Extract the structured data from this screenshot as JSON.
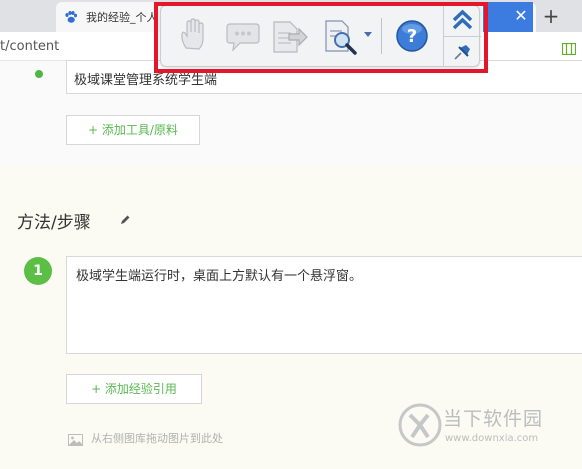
{
  "browser": {
    "tab_title": "我的经验_个人",
    "tab_icon": "baidu-paw-icon",
    "close_glyph": "✕",
    "new_tab_glyph": "+",
    "url_fragment": "t/content",
    "accent": "#3c7ce0"
  },
  "tools_section": {
    "tool_value": "极域课堂管理系统学生端",
    "add_button_label": "+ 添加工具/原料"
  },
  "method_section": {
    "title": "方法/步骤",
    "steps": [
      {
        "number": "1",
        "text": "极域学生端运行时，桌面上方默认有一个悬浮窗。"
      }
    ],
    "add_ref_label": "+ 添加经验引用",
    "image_hint": "从右侧图库拖动图片到此处"
  },
  "floating_toolbar": {
    "buttons": [
      "hand-raise-icon",
      "chat-bubble-icon",
      "file-submit-icon",
      "search-document-icon",
      "help-icon"
    ],
    "side_buttons": [
      "collapse-up-icon",
      "pin-icon"
    ],
    "help_glyph": "?",
    "highlight_color": "#e3162b"
  },
  "watermark": {
    "title": "当下软件园",
    "url": "www.downxia.com"
  },
  "colors": {
    "green": "#59b84f",
    "step_badge": "#5bbf45"
  }
}
